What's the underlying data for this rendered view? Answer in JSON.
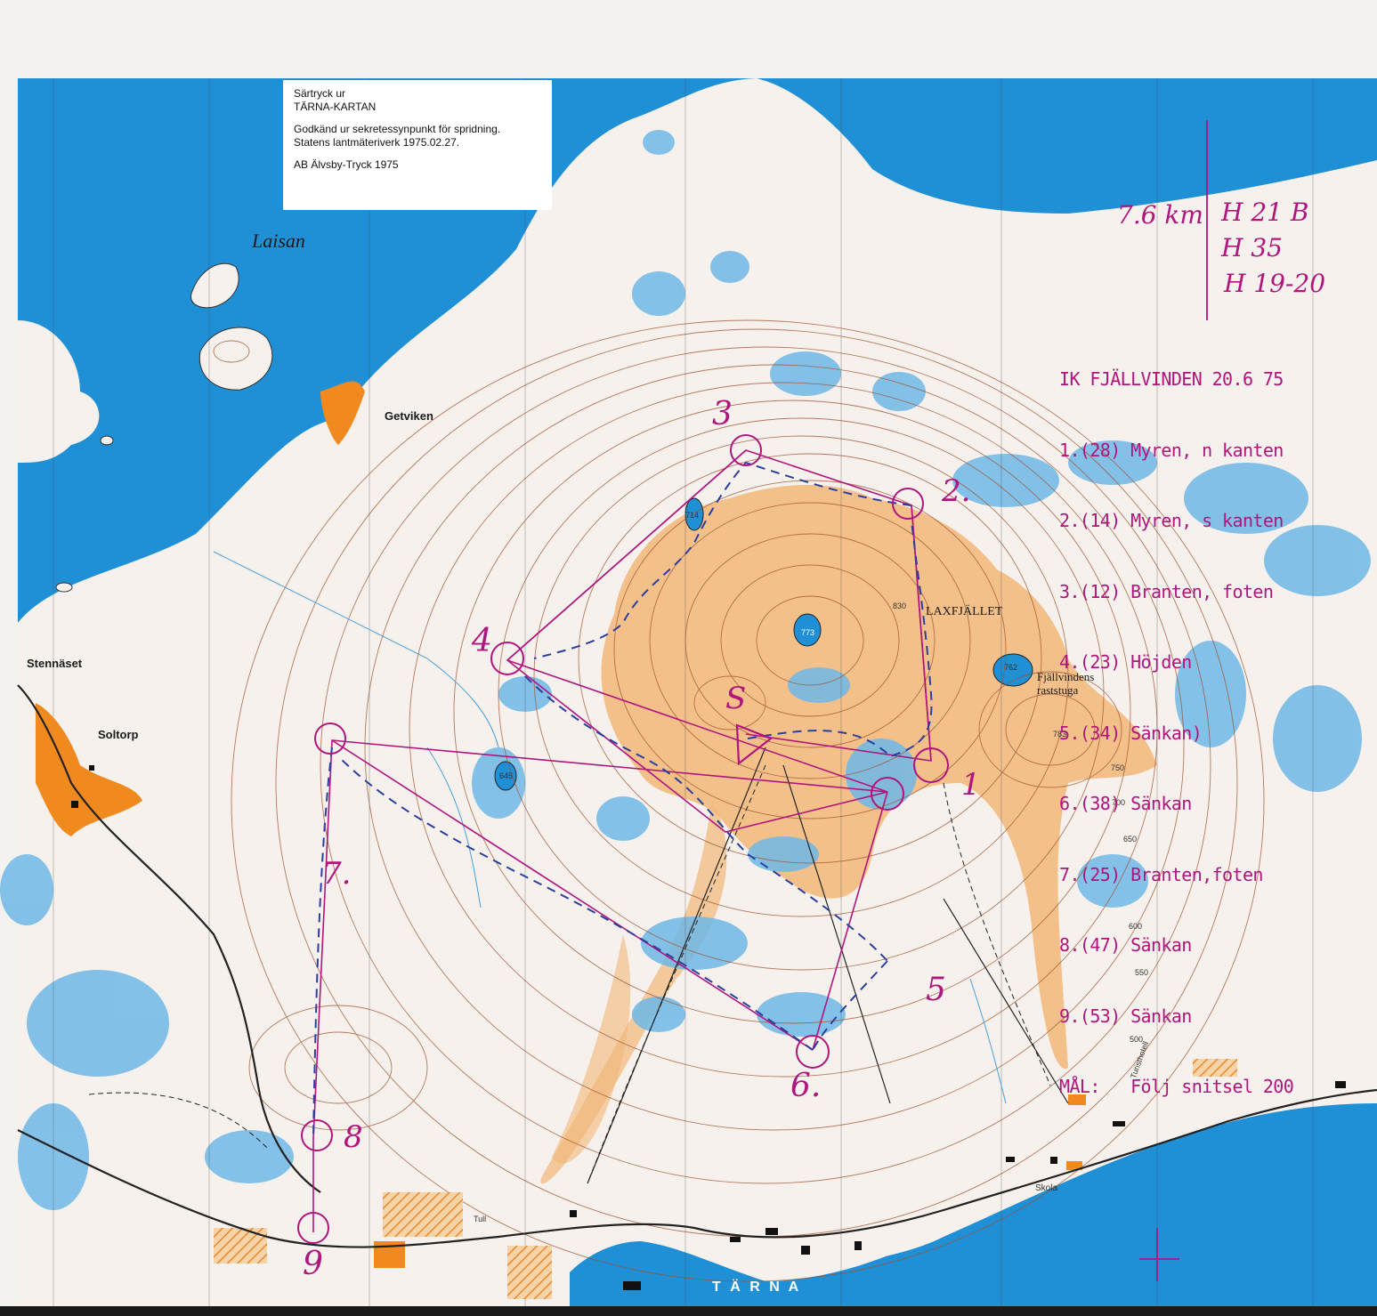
{
  "imprint": {
    "line1": "Särtryck ur",
    "line2": "TÄRNA-KARTAN",
    "line3": "Godkänd ur sekretessynpunkt för spridning.",
    "line4": "Statens lantmäteriverk 1975.02.27.",
    "line5": "AB Älvsby-Tryck 1975"
  },
  "place_names": {
    "laisan": "Laisan",
    "getviken": "Getviken",
    "stennaset": "Stennäset",
    "soltorp": "Soltorp",
    "laxfjallet": "LAXFJÄLLET",
    "fjallvindens": "Fjällvindens",
    "raststuga": "raststuga",
    "tarna": "T Ä R N A",
    "skola": "Skola",
    "tull": "Tull",
    "turisthotell": "Turisthotell"
  },
  "heights": {
    "h714": "714",
    "h773": "773",
    "h762": "762",
    "h630": "830",
    "h783": "783",
    "h645": "645",
    "c750": "750",
    "c700": "700",
    "c650": "650",
    "c600": "600",
    "c550": "550",
    "c500": "500"
  },
  "handwriting": {
    "distance": "7.6 km",
    "class1": "H 21 B",
    "class2": "H 35",
    "class3": "H 19-20"
  },
  "course": {
    "header": "IK FJÄLLVINDEN 20.6 75",
    "controls": [
      "1.(28) Myren, n kanten",
      "2.(14) Myren, s kanten",
      "3.(12) Branten, foten",
      "4.(23) Höjden",
      "5.(34) Sänkan)",
      "6.(38) Sänkan",
      "7.(25) Branten,foten",
      "8.(47) Sänkan",
      "9.(53) Sänkan",
      "MÅL:   Följ snitsel 200"
    ]
  },
  "control_numbers": {
    "start": "S",
    "c1": "1",
    "c2": "2.",
    "c3": "3",
    "c4": "4",
    "c5": "5",
    "c6": "6.",
    "c7": "7.",
    "c8": "8",
    "c9": "9"
  },
  "colors": {
    "water": "#1f8fd6",
    "land": "#f6f1ec",
    "open_land": "#f2b779",
    "contour": "#a0522d",
    "overprint": "#b0157e",
    "route": "#2a3f9e",
    "settlement": "#f08a1f"
  }
}
